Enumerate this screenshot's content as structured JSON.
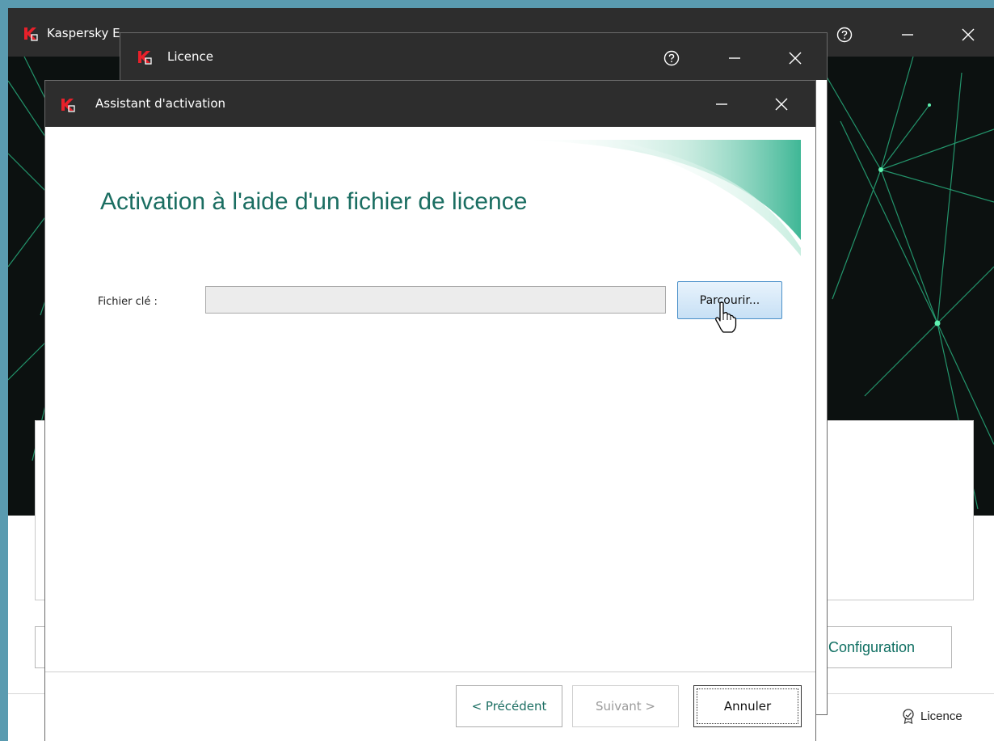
{
  "main_window": {
    "title": "Kaspersky Endpoint Security for Windows",
    "config_label": "Configuration",
    "licence_link": "Licence"
  },
  "licence_window": {
    "title": "Licence"
  },
  "assistant": {
    "title": "Assistant d'activation",
    "heading": "Activation à l'aide d'un fichier de licence",
    "file_label": "Fichier clé :",
    "file_value": "",
    "browse_label": "Parcourir...",
    "prev_label": "< Précédent",
    "next_label": "Suivant >",
    "cancel_label": "Annuler"
  },
  "colors": {
    "brand_red": "#e8202a",
    "accent_teal": "#1b6e62",
    "titlebar": "#2d2d2d"
  },
  "icons": [
    "kaspersky-logo-icon",
    "help-icon",
    "minimize-icon",
    "close-icon",
    "ribbon-icon",
    "hand-cursor-icon"
  ]
}
